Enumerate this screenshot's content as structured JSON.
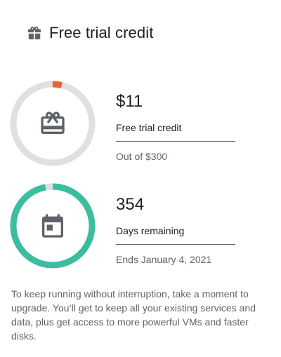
{
  "header": {
    "title": "Free trial credit",
    "icon": "gift-icon"
  },
  "credit": {
    "amount": "$11",
    "label": "Free trial credit",
    "sub": "Out of $300",
    "fraction": 0.0367,
    "icon": "credit-card-gift-icon",
    "colors": {
      "track": "#e0e0e0",
      "fill": "#e8652f"
    }
  },
  "days": {
    "count": "354",
    "label": "Days remaining",
    "sub": "Ends January 4, 2021",
    "fraction": 0.97,
    "icon": "calendar-icon",
    "colors": {
      "track": "#e0e0e0",
      "fill": "#3dbd9f"
    }
  },
  "footer": {
    "text": "To keep running without interruption, take a moment to upgrade. You’ll get to keep all your existing services and data, plus get access to more powerful VMs and faster disks."
  }
}
